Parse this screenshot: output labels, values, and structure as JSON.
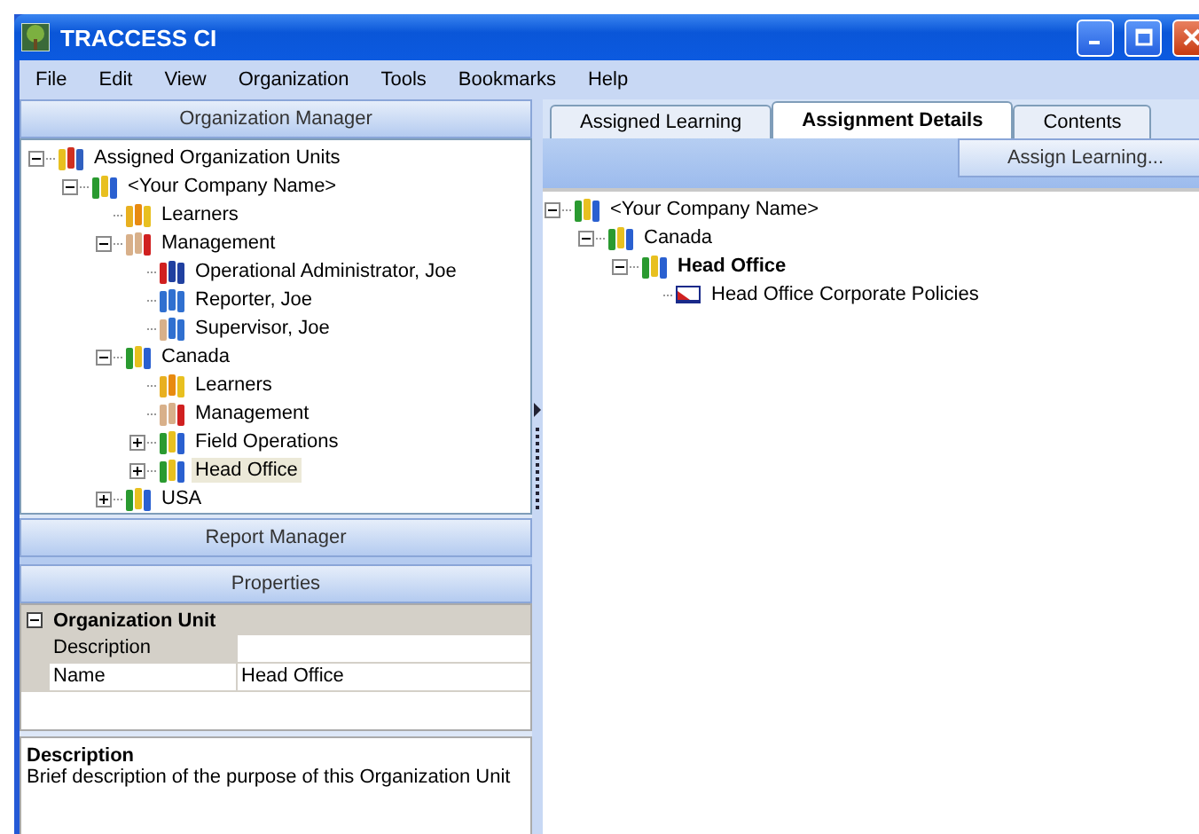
{
  "window": {
    "title": "TRACCESS CI"
  },
  "menu": [
    "File",
    "Edit",
    "View",
    "Organization",
    "Tools",
    "Bookmarks",
    "Help"
  ],
  "organization_manager": {
    "title": "Organization Manager",
    "tree": [
      {
        "label": "Assigned Organization Units",
        "kind": "root",
        "expanded": true,
        "selected": false,
        "children": [
          {
            "label": "<Your Company Name>",
            "kind": "company",
            "expanded": true,
            "selected": false,
            "children": [
              {
                "label": "Learners",
                "kind": "learners",
                "selected": false
              },
              {
                "label": "Management",
                "kind": "management",
                "expanded": true,
                "selected": false,
                "children": [
                  {
                    "label": "Operational Administrator, Joe",
                    "kind": "admin",
                    "selected": false
                  },
                  {
                    "label": "Reporter, Joe",
                    "kind": "reporter",
                    "selected": false
                  },
                  {
                    "label": "Supervisor, Joe",
                    "kind": "supervisor",
                    "selected": false
                  }
                ]
              },
              {
                "label": "Canada",
                "kind": "company",
                "expanded": true,
                "selected": false,
                "children": [
                  {
                    "label": "Learners",
                    "kind": "learners",
                    "selected": false
                  },
                  {
                    "label": "Management",
                    "kind": "management",
                    "selected": false
                  },
                  {
                    "label": "Field Operations",
                    "kind": "company",
                    "expanded": false,
                    "selected": false
                  },
                  {
                    "label": "Head Office",
                    "kind": "company",
                    "expanded": false,
                    "selected": true
                  }
                ]
              },
              {
                "label": "USA",
                "kind": "company",
                "expanded": false,
                "selected": false
              }
            ]
          }
        ]
      }
    ]
  },
  "report_manager": {
    "title": "Report Manager"
  },
  "properties": {
    "title": "Properties",
    "category": {
      "label": "Organization Unit",
      "expanded": true
    },
    "rows": [
      {
        "name": "Description",
        "selected": true
      },
      {
        "name": "Name",
        "value": "Head Office",
        "selected": false
      }
    ],
    "description": {
      "title": "Description",
      "text": "Brief description of the purpose of this Organization Unit"
    }
  },
  "tabs": [
    {
      "label": "Assigned Learning",
      "selected": false
    },
    {
      "label": "Assignment Details",
      "selected": true
    },
    {
      "label": "Contents",
      "selected": false
    }
  ],
  "toolbar": {
    "button": "Assign Learning..."
  },
  "details_tree": [
    {
      "label": "<Your Company Name>",
      "kind": "company",
      "expanded": true,
      "bold": false,
      "children": [
        {
          "label": "Canada",
          "kind": "company",
          "expanded": true,
          "bold": false,
          "children": [
            {
              "label": "Head Office",
              "kind": "company",
              "expanded": true,
              "bold": true,
              "children": [
                {
                  "label": "Head Office Corporate Policies",
                  "kind": "course",
                  "bold": false
                }
              ]
            }
          ]
        }
      ]
    }
  ]
}
